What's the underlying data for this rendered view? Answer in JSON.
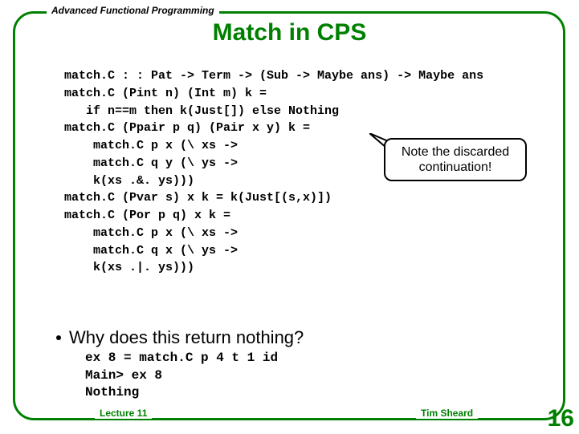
{
  "header": "Advanced Functional Programming",
  "title": "Match in CPS",
  "code": "match.C : : Pat -> Term -> (Sub -> Maybe ans) -> Maybe ans\nmatch.C (Pint n) (Int m) k =\n   if n==m then k(Just[]) else Nothing\nmatch.C (Ppair p q) (Pair x y) k =\n    match.C p x (\\ xs ->\n    match.C q y (\\ ys ->\n    k(xs .&. ys)))\nmatch.C (Pvar s) x k = k(Just[(s,x)])\nmatch.C (Por p q) x k =\n    match.C p x (\\ xs ->\n    match.C q x (\\ ys ->\n    k(xs .|. ys)))",
  "callout": "Note the discarded continuation!",
  "bullet": "Why does this return nothing?",
  "example": "ex 8 = match.C p 4 t 1 id\nMain> ex 8\nNothing",
  "footer": {
    "lecture": "Lecture 11",
    "author": "Tim Sheard",
    "page": "16"
  }
}
